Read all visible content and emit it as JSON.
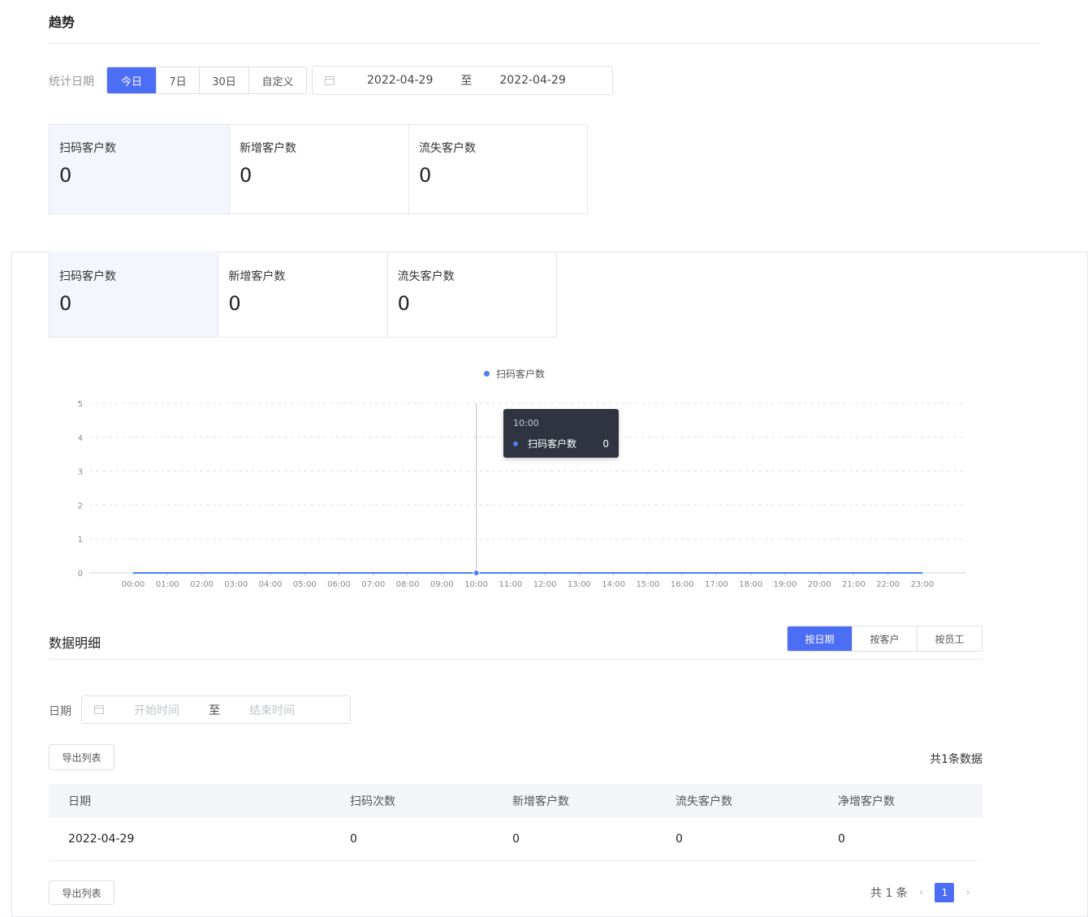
{
  "page": {
    "section_title": "趋势"
  },
  "stat_range": {
    "label": "统计日期",
    "options": [
      "今日",
      "7日",
      "30日",
      "自定义"
    ],
    "active": "今日",
    "start_date": "2022-04-29",
    "separator": "至",
    "end_date": "2022-04-29"
  },
  "stat_cards": [
    {
      "label": "扫码客户数",
      "value": "0"
    },
    {
      "label": "新增客户数",
      "value": "0"
    },
    {
      "label": "流失客户数",
      "value": "0"
    }
  ],
  "panel_cards": [
    {
      "label": "扫码客户数",
      "value": "0"
    },
    {
      "label": "新增客户数",
      "value": "0"
    },
    {
      "label": "流失客户数",
      "value": "0"
    }
  ],
  "chart_data": {
    "type": "line",
    "title": "",
    "xlabel": "",
    "ylabel": "",
    "legend": {
      "position": "top-center"
    },
    "grid": true,
    "ylim": [
      0,
      5
    ],
    "y_ticks": [
      "0",
      "1",
      "2",
      "3",
      "4",
      "5"
    ],
    "x": [
      "00:00",
      "01:00",
      "02:00",
      "03:00",
      "04:00",
      "05:00",
      "06:00",
      "07:00",
      "08:00",
      "09:00",
      "10:00",
      "11:00",
      "12:00",
      "13:00",
      "14:00",
      "15:00",
      "16:00",
      "17:00",
      "18:00",
      "19:00",
      "20:00",
      "21:00",
      "22:00",
      "23:00"
    ],
    "series": [
      {
        "name": "扫码客户数",
        "color": "#4e80ee",
        "values": [
          0,
          0,
          0,
          0,
          0,
          0,
          0,
          0,
          0,
          0,
          0,
          0,
          0,
          0,
          0,
          0,
          0,
          0,
          0,
          0,
          0,
          0,
          0,
          0
        ]
      }
    ],
    "tooltip": {
      "x": "10:00",
      "series": "扫码客户数",
      "value": "0"
    }
  },
  "detail": {
    "title": "数据明细",
    "tabs": [
      "按日期",
      "按客户",
      "按员工"
    ],
    "active_tab": "按日期",
    "date_filter": {
      "label": "日期",
      "start_placeholder": "开始时间",
      "separator": "至",
      "end_placeholder": "结束时间"
    },
    "export_label": "导出列表",
    "total_text": "共1条数据",
    "table": {
      "columns": [
        "日期",
        "扫码次数",
        "新增客户数",
        "流失客户数",
        "净增客户数"
      ],
      "rows": [
        [
          "2022-04-29",
          "0",
          "0",
          "0",
          "0"
        ]
      ]
    },
    "pagination": {
      "total_text": "共 1 条",
      "prev": "‹",
      "current": "1",
      "next": "›"
    }
  },
  "colors": {
    "accent": "#4c6ef5",
    "series": "#4e80ee",
    "card_active_bg": "#f3f6fd"
  }
}
